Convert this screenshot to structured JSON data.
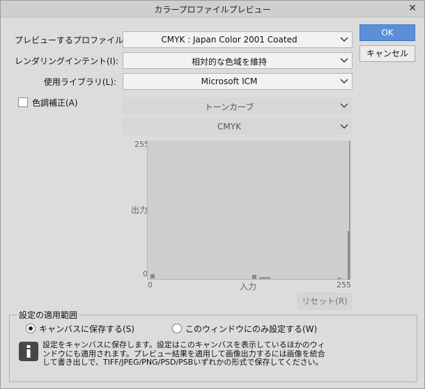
{
  "window": {
    "title": "カラープロファイルプレビュー",
    "close_glyph": "✕"
  },
  "buttons": {
    "ok": "OK",
    "cancel": "キャンセル",
    "reset": "リセット(R)"
  },
  "fields": {
    "preview_profile": {
      "label": "プレビューするプロファイル(C):",
      "value": "CMYK : Japan Color 2001 Coated"
    },
    "rendering_intent": {
      "label": "レンダリングインテント(I):",
      "value": "相対的な色域を維持"
    },
    "library": {
      "label": "使用ライブラリ(L):",
      "value": "Microsoft ICM"
    }
  },
  "color_correction": {
    "label": "色調補正(A)",
    "checked": false,
    "curve_type": "トーンカーブ",
    "channel": "CMYK"
  },
  "graph": {
    "y_max": "255",
    "y_min": "0",
    "x_min": "0",
    "x_max": "255",
    "ylabel": "出力",
    "xlabel": "入力"
  },
  "scope": {
    "title": "設定の適用範囲",
    "options": [
      {
        "label": "キャンバスに保存する(S)",
        "selected": true
      },
      {
        "label": "このウィンドウにのみ設定する(W)",
        "selected": false
      }
    ],
    "info_icon": "info-icon",
    "info_lines": [
      "設定をキャンバスに保存します。設定はこのキャンバスを表示しているほかのウィ",
      "ンドウにも適用されます。プレビュー結果を適用して画像出力するには画像を統合",
      "して書き出しで、TIFF/JPEG/PNG/PSD/PSBいずれかの形式で保存してください。"
    ]
  },
  "colors": {
    "accent": "#5b8fd8",
    "dialog_bg": "#dcdcdc",
    "graph_bg": "#cfcfcf"
  }
}
